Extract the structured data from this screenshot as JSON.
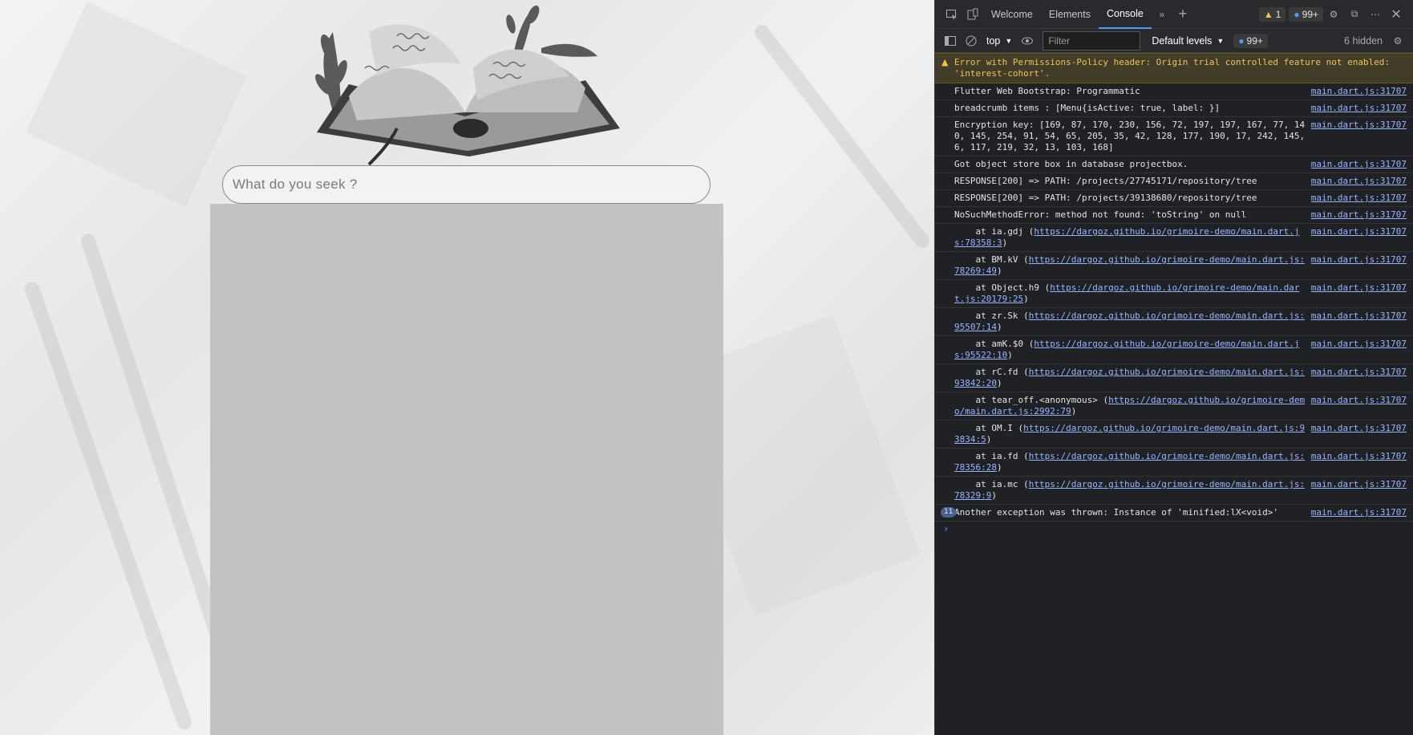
{
  "app": {
    "search": {
      "placeholder": "What do you seek ?"
    }
  },
  "devtools": {
    "tabs": [
      "Welcome",
      "Elements",
      "Console"
    ],
    "active_tab": "Console",
    "warning_count": "1",
    "issues_count": "99+",
    "context": "top",
    "filter_placeholder": "Filter",
    "levels_label": "Default levels",
    "toolbar_issues": "99+",
    "hidden_label": "6 hidden",
    "warning_message": "Error with Permissions-Policy header: Origin trial controlled feature not enabled: 'interest-cohort'.",
    "logs": [
      {
        "text": "Flutter Web Bootstrap: Programmatic",
        "src": "main.dart.js:31707"
      },
      {
        "text": "breadcrumb items : [Menu{isActive: true, label: }]",
        "src": "main.dart.js:31707"
      },
      {
        "text": "Encryption key: [169, 87, 170, 230, 156, 72, 197, 197, 167, 77, 140, 145, 254, 91, 54, 65, 205, 35, 42, 128, 177, 190, 17, 242, 145, 6, 117, 219, 32, 13, 103, 168]",
        "src": "main.dart.js:31707"
      },
      {
        "text": "Got object store box in database projectbox.",
        "src": "main.dart.js:31707"
      },
      {
        "text": "RESPONSE[200] => PATH: /projects/27745171/repository/tree",
        "src": "main.dart.js:31707"
      },
      {
        "text": "RESPONSE[200] => PATH: /projects/39138680/repository/tree",
        "src": "main.dart.js:31707"
      },
      {
        "text": "NoSuchMethodError: method not found: 'toString' on null",
        "src": "main.dart.js:31707"
      }
    ],
    "trace": [
      {
        "prefix": "    at ia.gdj (",
        "link": "https://dargoz.github.io/grimoire-demo/main.dart.js:78358:3",
        "suffix": ")",
        "src": "main.dart.js:31707"
      },
      {
        "prefix": "    at BM.kV (",
        "link": "https://dargoz.github.io/grimoire-demo/main.dart.js:78269:49",
        "suffix": ")",
        "src": "main.dart.js:31707"
      },
      {
        "prefix": "    at Object.h9 (",
        "link": "https://dargoz.github.io/grimoire-demo/main.dart.js:20179:25",
        "suffix": ")",
        "src": "main.dart.js:31707"
      },
      {
        "prefix": "    at zr.Sk (",
        "link": "https://dargoz.github.io/grimoire-demo/main.dart.js:95507:14",
        "suffix": ")",
        "src": "main.dart.js:31707"
      },
      {
        "prefix": "    at amK.$0 (",
        "link": "https://dargoz.github.io/grimoire-demo/main.dart.js:95522:10",
        "suffix": ")",
        "src": "main.dart.js:31707"
      },
      {
        "prefix": "    at rC.fd (",
        "link": "https://dargoz.github.io/grimoire-demo/main.dart.js:93842:20",
        "suffix": ")",
        "src": "main.dart.js:31707"
      },
      {
        "prefix": "    at tear_off.<anonymous> (",
        "link": "https://dargoz.github.io/grimoire-demo/main.dart.js:2992:79",
        "suffix": ")",
        "src": "main.dart.js:31707"
      },
      {
        "prefix": "    at OM.I (",
        "link": "https://dargoz.github.io/grimoire-demo/main.dart.js:93834:5",
        "suffix": ")",
        "src": "main.dart.js:31707"
      },
      {
        "prefix": "    at ia.fd (",
        "link": "https://dargoz.github.io/grimoire-demo/main.dart.js:78356:28",
        "suffix": ")",
        "src": "main.dart.js:31707"
      },
      {
        "prefix": "    at ia.mc (",
        "link": "https://dargoz.github.io/grimoire-demo/main.dart.js:78329:9",
        "suffix": ")",
        "src": "main.dart.js:31707"
      }
    ],
    "repeat": {
      "count": "11",
      "text": "Another exception was thrown: Instance of 'minified:lX<void>'",
      "src": "main.dart.js:31707"
    },
    "prompt": "›"
  }
}
